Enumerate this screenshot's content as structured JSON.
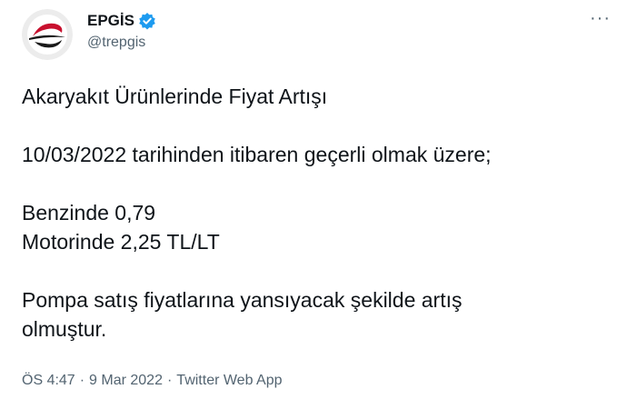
{
  "author": {
    "display_name": "EPGİS",
    "handle": "@trepgis"
  },
  "more_label": "···",
  "tweet": {
    "line1": "Akaryakıt Ürünlerinde Fiyat Artışı",
    "line2": "10/03/2022 tarihinden itibaren geçerli olmak üzere;",
    "line3": "Benzinde 0,79",
    "line4": "Motorinde 2,25 TL/LT",
    "line5": "Pompa satış fiyatlarına yansıyacak şekilde artış",
    "line6": "olmuştur."
  },
  "meta": {
    "time": "ÖS 4:47",
    "separator": "·",
    "date": "9 Mar 2022",
    "source": "Twitter Web App"
  },
  "colors": {
    "text": "#0f1419",
    "secondary": "#536471",
    "verified": "#1d9bf0",
    "logo_red": "#c8102e"
  }
}
